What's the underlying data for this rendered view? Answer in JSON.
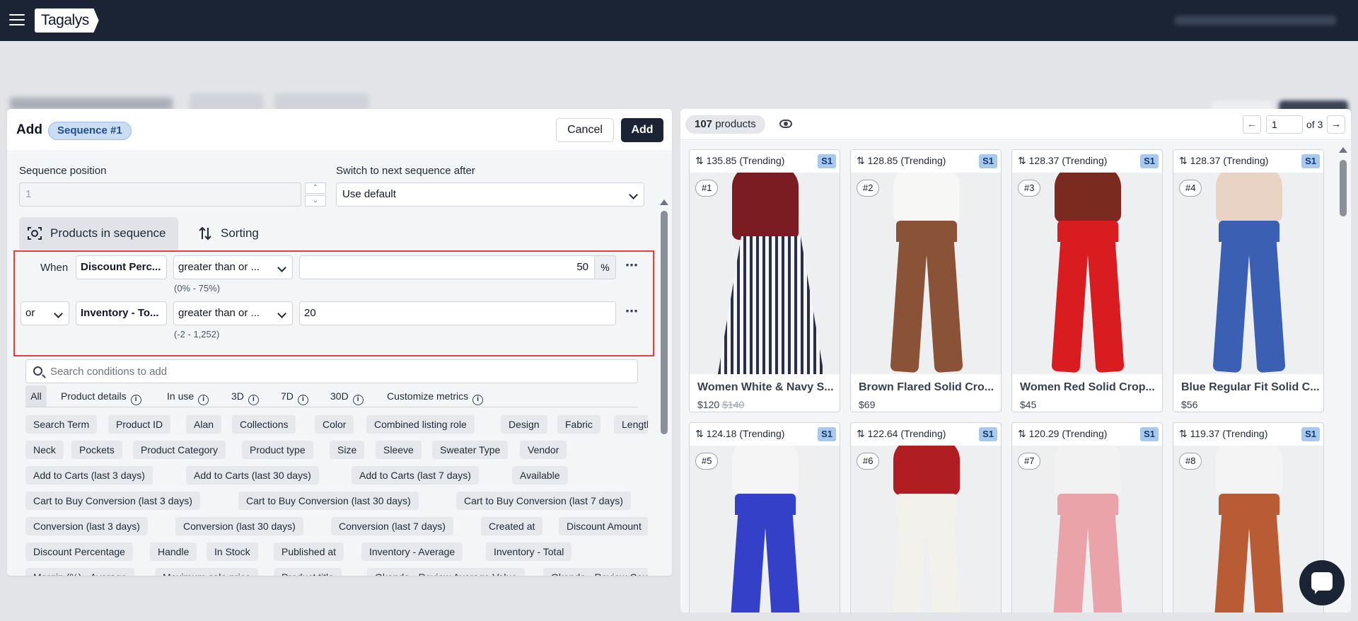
{
  "app": {
    "logo": "Tagalys"
  },
  "panel": {
    "title": "Add",
    "sequence_badge": "Sequence #1",
    "cancel_label": "Cancel",
    "add_label": "Add"
  },
  "form": {
    "position_label": "Sequence position",
    "position_value": "1",
    "switch_label": "Switch to next sequence after",
    "switch_value": "Use default"
  },
  "tabs": {
    "products": "Products in sequence",
    "sorting": "Sorting"
  },
  "conditions": {
    "when_label": "When",
    "rows": [
      {
        "attribute": "Discount Perc...",
        "operator": "greater than or ...",
        "value": "50",
        "suffix": "%",
        "range": "(0% - 75%)"
      },
      {
        "connector": "or",
        "attribute": "Inventory - To...",
        "operator": "greater than or ...",
        "value": "20",
        "range": "(-2 - 1,252)"
      }
    ]
  },
  "search": {
    "placeholder": "Search conditions to add"
  },
  "filter_tabs": [
    "All",
    "Product details",
    "In use",
    "3D",
    "7D",
    "30D",
    "Customize metrics"
  ],
  "chips": [
    [
      "Search Term",
      "Product ID",
      "Alan",
      "Collections",
      "Color",
      "Combined listing role",
      "Design",
      "Fabric",
      "Length"
    ],
    [
      "Neck",
      "Pockets",
      "Product Category",
      "Product type",
      "Size",
      "Sleeve",
      "Sweater Type",
      "Vendor"
    ],
    [
      "Add to Carts (last 3 days)",
      "Add to Carts (last 30 days)",
      "Add to Carts (last 7 days)",
      "Available"
    ],
    [
      "Cart to Buy Conversion (last 3 days)",
      "Cart to Buy Conversion (last 30 days)",
      "Cart to Buy Conversion (last 7 days)"
    ],
    [
      "Conversion (last 3 days)",
      "Conversion (last 30 days)",
      "Conversion (last 7 days)",
      "Created at",
      "Discount Amount"
    ],
    [
      "Discount Percentage",
      "Handle",
      "In Stock",
      "Published at",
      "Inventory - Average",
      "Inventory - Total"
    ],
    [
      "Margin (%) - Average",
      "Maximum sale price",
      "Product title",
      "Okendo - Review Average Value",
      "Okendo - Review Count"
    ]
  ],
  "results": {
    "count": "107",
    "count_suffix": " products",
    "page": "1",
    "of_label": "of 3",
    "products": [
      {
        "score": "135.85 (Trending)",
        "tag": "S1",
        "rank": "#1",
        "name": "Women White & Navy S...",
        "price": "$120",
        "compare": "$140",
        "top": "#7a1c22",
        "bottom": "#2b2f45",
        "pants": false
      },
      {
        "score": "128.85 (Trending)",
        "tag": "S1",
        "rank": "#2",
        "name": "Brown Flared Solid Cro...",
        "price": "$69",
        "compare": "",
        "top": "#f7f7f5",
        "bottom": "#8a5236",
        "pants": true
      },
      {
        "score": "128.37 (Trending)",
        "tag": "S1",
        "rank": "#3",
        "name": "Women Red Solid Crop...",
        "price": "$45",
        "compare": "",
        "top": "#7b2a1f",
        "bottom": "#d81c20",
        "pants": true
      },
      {
        "score": "128.37 (Trending)",
        "tag": "S1",
        "rank": "#4",
        "name": "Blue Regular Fit Solid C...",
        "price": "$56",
        "compare": "",
        "top": "#e8d3c5",
        "bottom": "#3b5fb3",
        "pants": true
      },
      {
        "score": "124.18 (Trending)",
        "tag": "S1",
        "rank": "#5",
        "name": "",
        "price": "",
        "compare": "",
        "top": "#f5f5f5",
        "bottom": "#3540c9",
        "pants": true
      },
      {
        "score": "122.64 (Trending)",
        "tag": "S1",
        "rank": "#6",
        "name": "",
        "price": "",
        "compare": "",
        "top": "#b01e22",
        "bottom": "#f3f1ec",
        "pants": true
      },
      {
        "score": "120.29 (Trending)",
        "tag": "S1",
        "rank": "#7",
        "name": "",
        "price": "",
        "compare": "",
        "top": "#f2f2f2",
        "bottom": "#eaa3a8",
        "pants": true
      },
      {
        "score": "119.37 (Trending)",
        "tag": "S1",
        "rank": "#8",
        "name": "",
        "price": "",
        "compare": "",
        "top": "#f4f4f4",
        "bottom": "#b95c36",
        "pants": true
      }
    ]
  }
}
